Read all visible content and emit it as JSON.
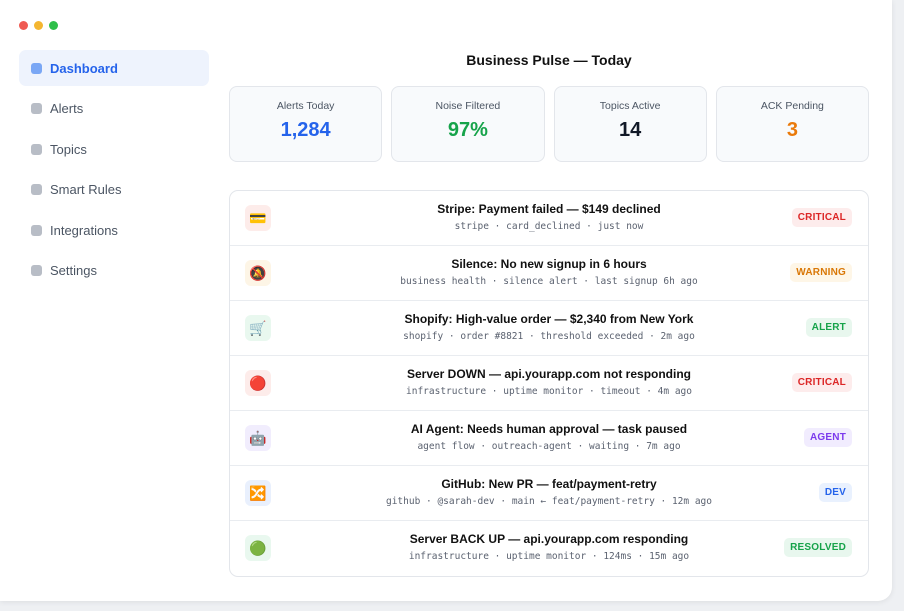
{
  "sidebar": {
    "items": [
      {
        "label": "Dashboard",
        "active": true
      },
      {
        "label": "Alerts"
      },
      {
        "label": "Topics"
      },
      {
        "label": "Smart Rules"
      },
      {
        "label": "Integrations"
      },
      {
        "label": "Settings"
      }
    ]
  },
  "main": {
    "title": "Business Pulse — Today",
    "stats": [
      {
        "label": "Alerts Today",
        "value": "1,284",
        "color": "#2563eb"
      },
      {
        "label": "Noise Filtered",
        "value": "97%",
        "color": "#16a34a"
      },
      {
        "label": "Topics Active",
        "value": "14",
        "color": "#111827"
      },
      {
        "label": "ACK Pending",
        "value": "3",
        "color": "#ea7a0b"
      }
    ],
    "alerts": [
      {
        "icon": "credit-card-icon",
        "glyph": "💳",
        "icon_bg": "#fdecea",
        "title": "Stripe: Payment failed — $149 declined",
        "meta": "stripe · card_declined · just now",
        "badge": "CRITICAL",
        "badge_color": "#dc2626",
        "badge_bg": "#fdecec"
      },
      {
        "icon": "muted-bell-icon",
        "glyph": "🔕",
        "icon_bg": "#fdf5e6",
        "title": "Silence: No new signup in 6 hours",
        "meta": "business health · silence alert · last signup 6h ago",
        "badge": "WARNING",
        "badge_color": "#d97706",
        "badge_bg": "#fef6e7"
      },
      {
        "icon": "shopping-cart-icon",
        "glyph": "🛒",
        "icon_bg": "#e9f8ef",
        "title": "Shopify: High-value order — $2,340 from New York",
        "meta": "shopify · order #8821 · threshold exceeded · 2m ago",
        "badge": "ALERT",
        "badge_color": "#16a34a",
        "badge_bg": "#e8f7ee"
      },
      {
        "icon": "red-circle-icon",
        "glyph": "🔴",
        "icon_bg": "#fdecea",
        "title": "Server DOWN — api.yourapp.com not responding",
        "meta": "infrastructure · uptime monitor · timeout · 4m ago",
        "badge": "CRITICAL",
        "badge_color": "#dc2626",
        "badge_bg": "#fdecec"
      },
      {
        "icon": "robot-icon",
        "glyph": "🤖",
        "icon_bg": "#f1edfd",
        "title": "AI Agent: Needs human approval — task paused",
        "meta": "agent flow · outreach-agent · waiting · 7m ago",
        "badge": "AGENT",
        "badge_color": "#7c3aed",
        "badge_bg": "#f1ecfe"
      },
      {
        "icon": "shuffle-icon",
        "glyph": "🔀",
        "icon_bg": "#e9f0fd",
        "title": "GitHub: New PR — feat/payment-retry",
        "meta": "github · @sarah-dev · main ← feat/payment-retry · 12m ago",
        "badge": "DEV",
        "badge_color": "#2563eb",
        "badge_bg": "#e9f1fe"
      },
      {
        "icon": "green-circle-icon",
        "glyph": "🟢",
        "icon_bg": "#e9f8ef",
        "title": "Server BACK UP — api.yourapp.com responding",
        "meta": "infrastructure · uptime monitor · 124ms · 15m ago",
        "badge": "RESOLVED",
        "badge_color": "#16a34a",
        "badge_bg": "#e8f7ee"
      }
    ]
  }
}
